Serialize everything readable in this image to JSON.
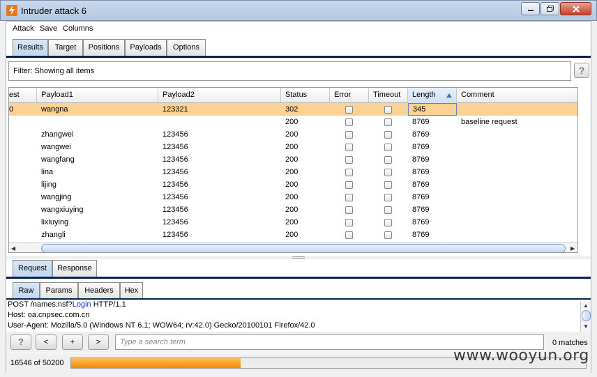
{
  "window": {
    "title": "Intruder attack 6"
  },
  "menu": [
    "Attack",
    "Save",
    "Columns"
  ],
  "top_tabs": [
    {
      "label": "Results",
      "active": true
    },
    {
      "label": "Target",
      "active": false
    },
    {
      "label": "Positions",
      "active": false
    },
    {
      "label": "Payloads",
      "active": false
    },
    {
      "label": "Options",
      "active": false
    }
  ],
  "filter": {
    "text": "Filter:  Showing all items"
  },
  "help_label": "?",
  "table": {
    "columns": [
      "est",
      "Payload1",
      "Payload2",
      "Status",
      "Error",
      "Timeout",
      "Length",
      "Comment"
    ],
    "sorted_column": "Length",
    "rows": [
      {
        "req": "0",
        "p1": "wangna",
        "p2": "123321",
        "status": "302",
        "error": false,
        "timeout": false,
        "length": "345",
        "comment": "",
        "selected": true
      },
      {
        "req": "",
        "p1": "",
        "p2": "",
        "status": "200",
        "error": false,
        "timeout": false,
        "length": "8769",
        "comment": "baseline request",
        "selected": false
      },
      {
        "req": "",
        "p1": "zhangwei",
        "p2": "123456",
        "status": "200",
        "error": false,
        "timeout": false,
        "length": "8769",
        "comment": "",
        "selected": false
      },
      {
        "req": "",
        "p1": "wangwei",
        "p2": "123456",
        "status": "200",
        "error": false,
        "timeout": false,
        "length": "8769",
        "comment": "",
        "selected": false
      },
      {
        "req": "",
        "p1": "wangfang",
        "p2": "123456",
        "status": "200",
        "error": false,
        "timeout": false,
        "length": "8769",
        "comment": "",
        "selected": false
      },
      {
        "req": "",
        "p1": "lina",
        "p2": "123456",
        "status": "200",
        "error": false,
        "timeout": false,
        "length": "8769",
        "comment": "",
        "selected": false
      },
      {
        "req": "",
        "p1": "lijing",
        "p2": "123456",
        "status": "200",
        "error": false,
        "timeout": false,
        "length": "8769",
        "comment": "",
        "selected": false
      },
      {
        "req": "",
        "p1": "wangjing",
        "p2": "123456",
        "status": "200",
        "error": false,
        "timeout": false,
        "length": "8769",
        "comment": "",
        "selected": false
      },
      {
        "req": "",
        "p1": "wangxiuying",
        "p2": "123456",
        "status": "200",
        "error": false,
        "timeout": false,
        "length": "8769",
        "comment": "",
        "selected": false
      },
      {
        "req": "",
        "p1": "lixiuying",
        "p2": "123456",
        "status": "200",
        "error": false,
        "timeout": false,
        "length": "8769",
        "comment": "",
        "selected": false
      },
      {
        "req": "",
        "p1": "zhangli",
        "p2": "123456",
        "status": "200",
        "error": false,
        "timeout": false,
        "length": "8769",
        "comment": "",
        "selected": false
      }
    ]
  },
  "req_tabs": [
    {
      "label": "Request",
      "active": true
    },
    {
      "label": "Response",
      "active": false
    }
  ],
  "view_tabs": [
    {
      "label": "Raw",
      "active": true
    },
    {
      "label": "Params",
      "active": false
    },
    {
      "label": "Headers",
      "active": false
    },
    {
      "label": "Hex",
      "active": false
    }
  ],
  "request_lines": {
    "line1_prefix": "POST /names.nsf?",
    "line1_keyword": "Login",
    "line1_suffix": " HTTP/1.1",
    "line2": "Host: oa.cnpsec.com.cn",
    "line3": "User-Agent: Mozilla/5.0 (Windows NT 6.1; WOW64; rv:42.0) Gecko/20100101 Firefox/42.0"
  },
  "search": {
    "help": "?",
    "prev": "<",
    "add": "+",
    "next": ">",
    "placeholder": "Type a search term",
    "matches": "0 matches"
  },
  "progress": {
    "text": "16546 of 50200",
    "fraction": 0.3296
  },
  "watermark": "www.wooyun.org"
}
